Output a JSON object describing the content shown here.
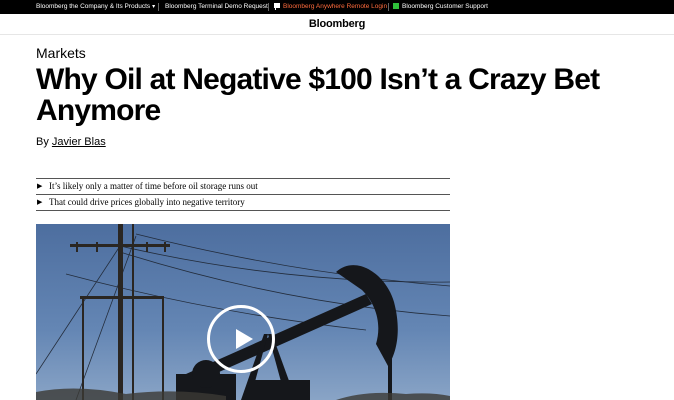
{
  "topbar": {
    "company_link": "Bloomberg the Company & Its Products",
    "terminal_demo": "Bloomberg Terminal Demo Request",
    "anywhere_login": "Bloomberg Anywhere Remote Login",
    "customer_support": "Bloomberg Customer Support",
    "accent_color": "#ff6b3d"
  },
  "header": {
    "logo": "Bloomberg"
  },
  "article": {
    "section": "Markets",
    "headline": "Why Oil at Negative $100 Isn’t a Crazy Bet Anymore",
    "byline_prefix": "By",
    "author": "Javier Blas",
    "bullets": [
      "It’s likely only a matter of time before oil storage runs out",
      "That could drive prices globally into negative territory"
    ]
  },
  "media": {
    "play_icon": "play-circle-icon"
  }
}
